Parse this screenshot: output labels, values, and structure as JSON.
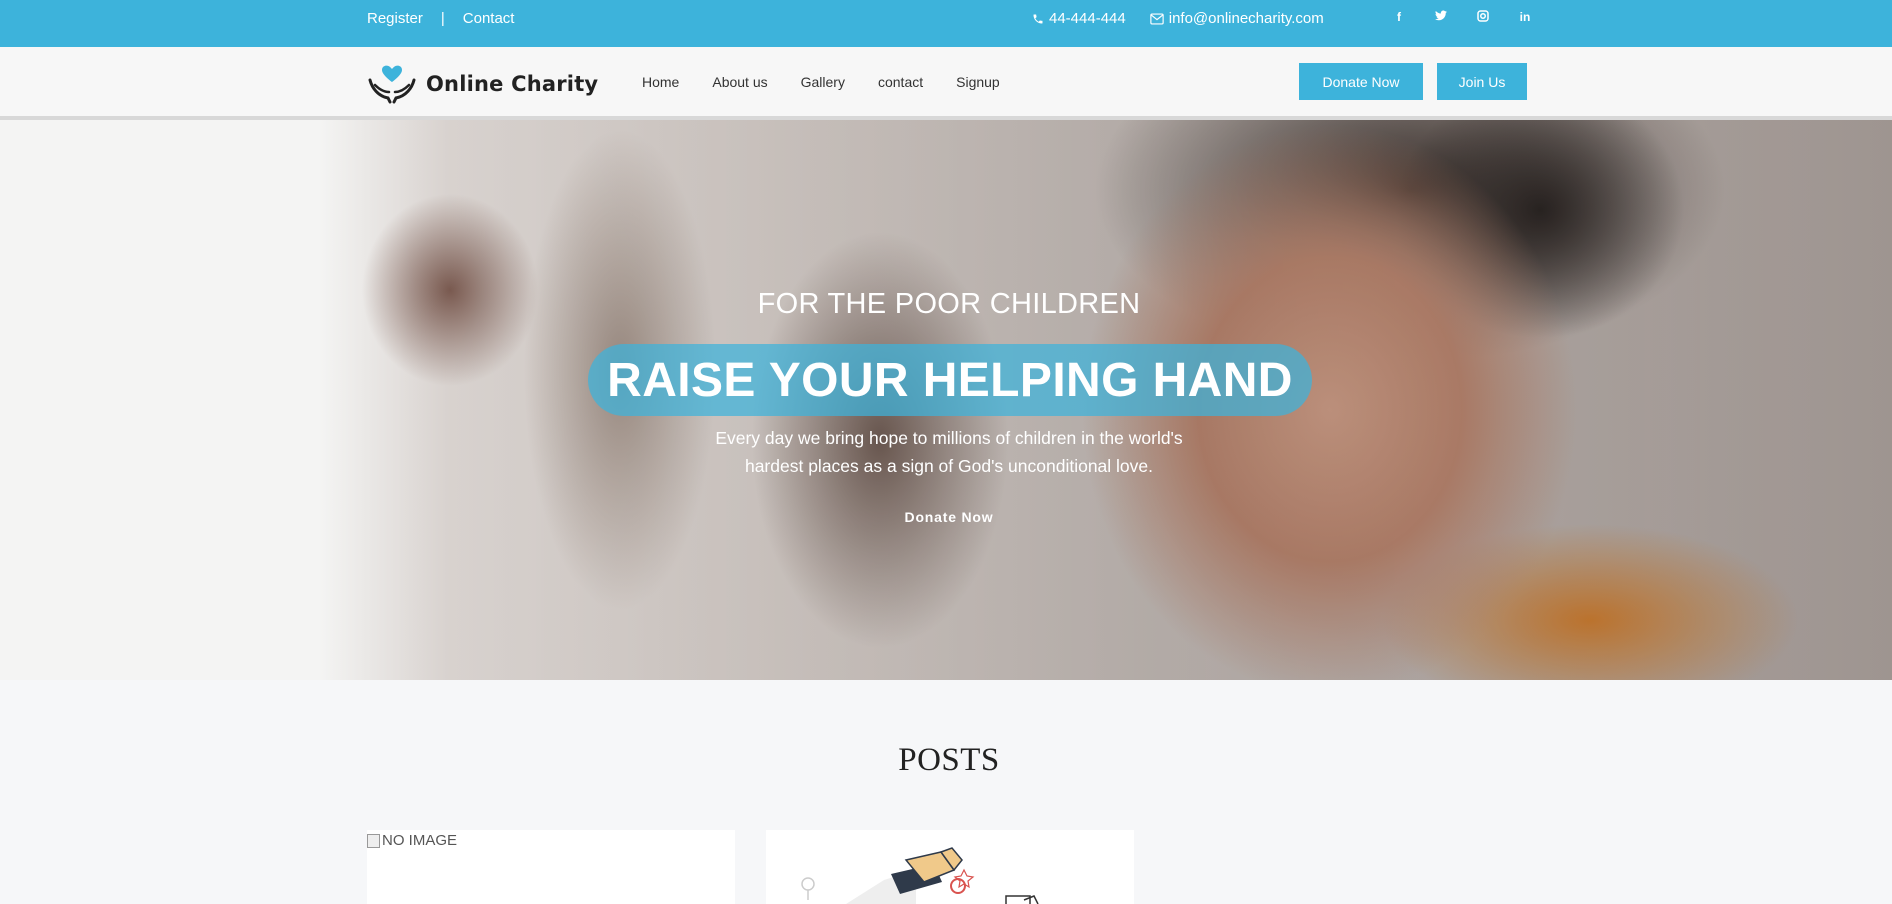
{
  "topbar": {
    "register": "Register",
    "separator": "|",
    "contact": "Contact",
    "phone": "44-444-444",
    "email": "info@onlinecharity.com",
    "social": [
      "facebook-icon",
      "twitter-icon",
      "instagram-icon",
      "linkedin-icon"
    ],
    "background": "#3db3db"
  },
  "nav": {
    "logo_text": "Online Charity",
    "items": [
      "Home",
      "About us",
      "Gallery",
      "contact",
      "Signup"
    ],
    "donate_button": "Donate Now",
    "join_button": "Join Us",
    "accent": "#3db3db"
  },
  "hero": {
    "subtitle": "FOR THE POOR CHILDREN",
    "title": "RAISE YOUR HELPING HAND",
    "description_line1": "Every day we bring hope to millions of children in the world's",
    "description_line2": "hardest places as a sign of God's unconditional love.",
    "cta": "Donate Now"
  },
  "posts": {
    "heading": "POSTS",
    "cards": [
      {
        "image_alt": "NO IMAGE"
      },
      {
        "image_alt": ""
      }
    ]
  }
}
